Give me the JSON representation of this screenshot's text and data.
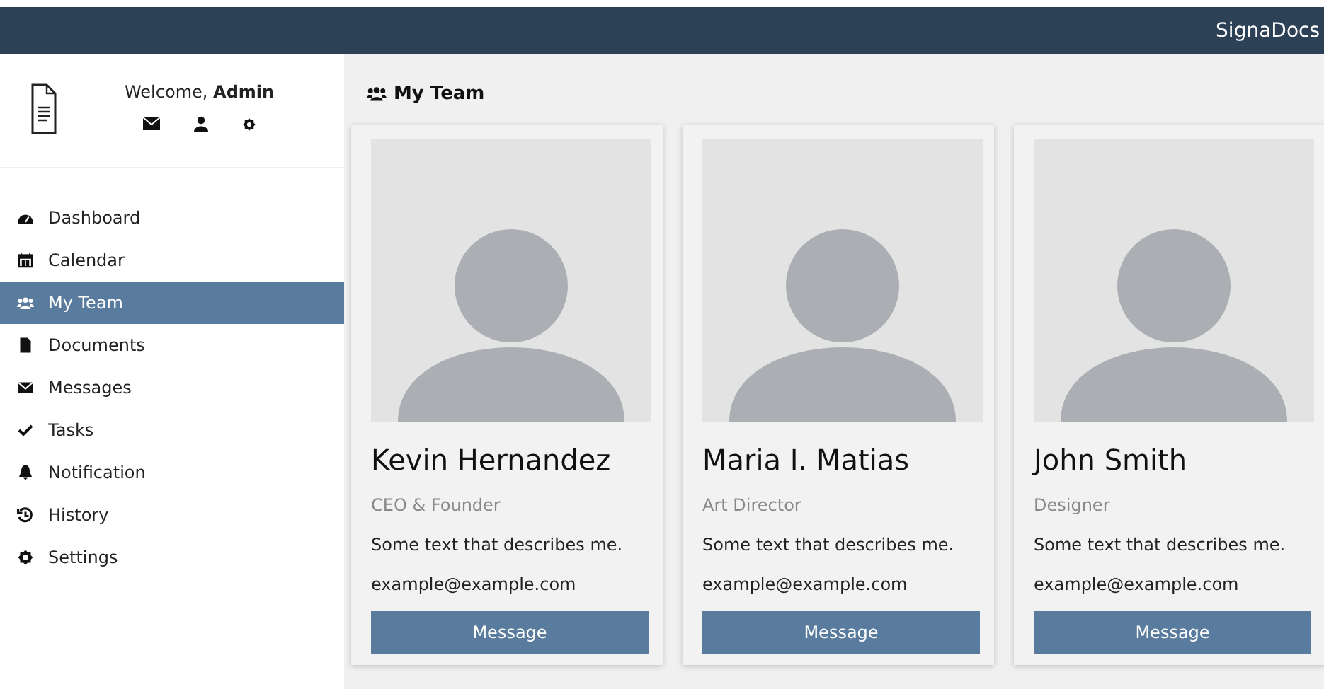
{
  "topbar": {
    "brand": "SignaDocs"
  },
  "sidebar": {
    "welcome": "Welcome, **Admin**",
    "items": [
      {
        "label": "Dashboard",
        "selected": false
      },
      {
        "label": "Calendar",
        "selected": false
      },
      {
        "label": "My Team",
        "selected": true
      },
      {
        "label": "Documents",
        "selected": false
      },
      {
        "label": "Messages",
        "selected": false
      },
      {
        "label": "Tasks",
        "selected": false
      },
      {
        "label": "Notification",
        "selected": false
      },
      {
        "label": "History",
        "selected": false
      },
      {
        "label": "Settings",
        "selected": false
      }
    ]
  },
  "main": {
    "title": "My Team",
    "cards": [
      {
        "name": "Kevin Hernandez",
        "role": "CEO & Founder",
        "description": "Some text that describes me.",
        "email": "example@example.com",
        "button": "Message"
      },
      {
        "name": "Maria I. Matias",
        "role": "Art Director",
        "description": "Some text that describes me.",
        "email": "example@example.com",
        "button": "Message"
      },
      {
        "name": "John Smith",
        "role": "Designer",
        "description": "Some text that describes me.",
        "email": "example@example.com",
        "button": "Message"
      }
    ]
  }
}
